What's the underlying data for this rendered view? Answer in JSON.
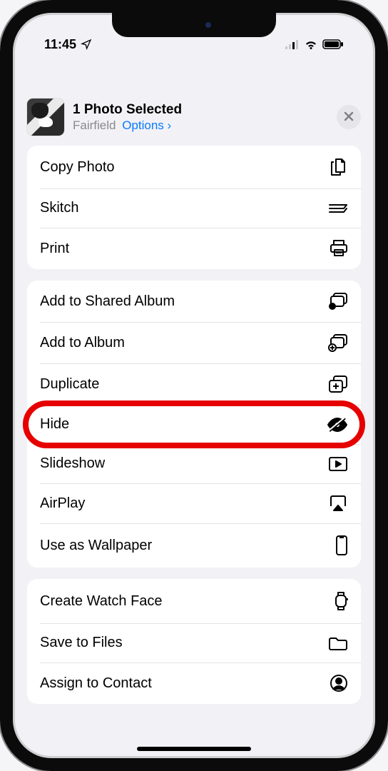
{
  "status": {
    "time": "11:45"
  },
  "header": {
    "title": "1 Photo Selected",
    "location": "Fairfield",
    "options_label": "Options",
    "chevron": "›"
  },
  "groups": [
    {
      "items": [
        {
          "label": "Copy Photo",
          "icon": "copy-icon"
        },
        {
          "label": "Skitch",
          "icon": "skitch-icon"
        },
        {
          "label": "Print",
          "icon": "print-icon"
        }
      ]
    },
    {
      "items": [
        {
          "label": "Add to Shared Album",
          "icon": "shared-album-icon"
        },
        {
          "label": "Add to Album",
          "icon": "add-album-icon"
        },
        {
          "label": "Duplicate",
          "icon": "duplicate-icon"
        },
        {
          "label": "Hide",
          "icon": "hide-icon",
          "highlight": true
        },
        {
          "label": "Slideshow",
          "icon": "slideshow-icon"
        },
        {
          "label": "AirPlay",
          "icon": "airplay-icon"
        },
        {
          "label": "Use as Wallpaper",
          "icon": "wallpaper-icon"
        }
      ]
    },
    {
      "items": [
        {
          "label": "Create Watch Face",
          "icon": "watch-icon"
        },
        {
          "label": "Save to Files",
          "icon": "files-icon"
        },
        {
          "label": "Assign to Contact",
          "icon": "contact-icon"
        }
      ]
    }
  ]
}
